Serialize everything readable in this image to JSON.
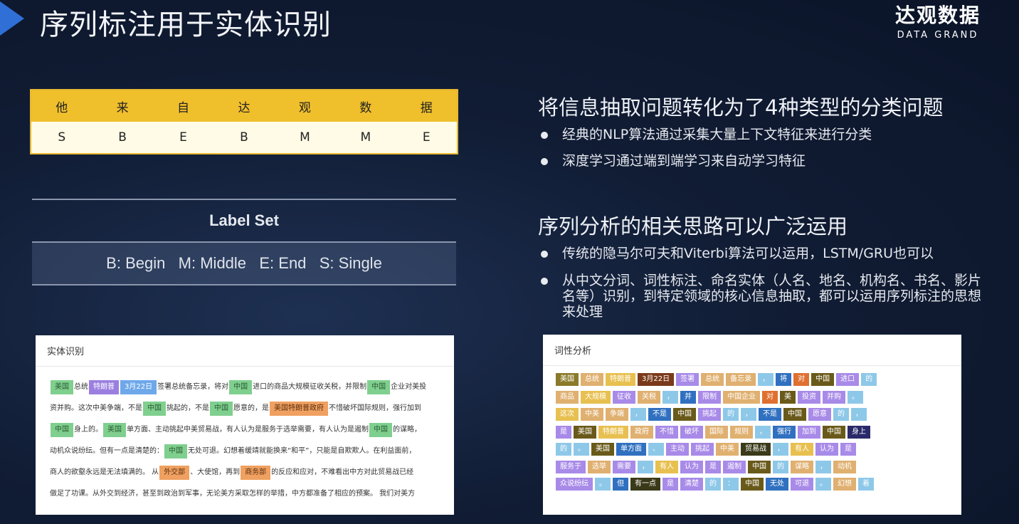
{
  "slide": {
    "title": "序列标注用于实体识别",
    "brand_cn": "达观数据",
    "brand_en": "DATA GRAND"
  },
  "sequence_table": {
    "chars": [
      "他",
      "来",
      "自",
      "达",
      "观",
      "数",
      "据"
    ],
    "labels": [
      "S",
      "B",
      "E",
      "B",
      "M",
      "M",
      "E"
    ]
  },
  "label_set": {
    "title": "Label Set",
    "text": "B: Begin   M: Middle   E: End   S: Single"
  },
  "right": {
    "heading1": "将信息抽取问题转化为了4种类型的分类问题",
    "bullets1": [
      "经典的NLP算法通过采集大量上下文特征来进行分类",
      "深度学习通过端到端学习来自动学习特征"
    ],
    "heading2": "序列分析的相关思路可以广泛运用",
    "bullets2": [
      "传统的隐马尔可夫和Viterbi算法可以运用，LSTM/GRU也可以",
      "从中文分词、词性标注、命名实体（人名、地名、机构名、书名、影片名等）识别，到特定领域的核心信息抽取，都可以运用序列标注的思想来处理"
    ]
  },
  "ner_card": {
    "title": "实体识别",
    "lines": [
      [
        [
          "g",
          "美国"
        ],
        [
          "",
          "总统"
        ],
        [
          "p",
          "特朗普"
        ],
        [
          "b",
          "3月22日"
        ],
        [
          "",
          "签署总统备忘录，将对"
        ],
        [
          "g",
          "中国"
        ],
        [
          "",
          "进口的商品大规模征收关税，并限制"
        ],
        [
          "g",
          "中国"
        ],
        [
          "",
          "企业对美投"
        ]
      ],
      [
        [
          "",
          "资并购。这次中美争端，不是"
        ],
        [
          "g",
          "中国"
        ],
        [
          "",
          "挑起的，不是"
        ],
        [
          "g",
          "中国"
        ],
        [
          "",
          "愿意的，是"
        ],
        [
          "o",
          "美国特朗普政府"
        ],
        [
          "",
          "不惜破坏国际规则，强行加到"
        ]
      ],
      [
        [
          "g",
          "中国"
        ],
        [
          "",
          "身上的。"
        ],
        [
          "g",
          "美国"
        ],
        [
          "",
          "单方面、主动挑起中美贸易战，有人认为是服务于选举需要，有人认为是遏制"
        ],
        [
          "g",
          "中国"
        ],
        [
          "",
          "的谋略，"
        ]
      ],
      [
        [
          "",
          "动机众说纷纭。但有一点是清楚的："
        ],
        [
          "g",
          "中国"
        ],
        [
          "",
          "无处可退。幻想着缓靖就能换来“和平”，只能是自欺欺人。在利益面前，"
        ]
      ],
      [
        [
          "",
          "商人的欲壑永远是无法填满的。 从"
        ],
        [
          "o",
          "外交部"
        ],
        [
          "",
          "、大使馆，再到"
        ],
        [
          "o",
          "商务部"
        ],
        [
          "",
          "的反应和应对，不难看出中方对此贸易战已经"
        ]
      ],
      [
        [
          "",
          "做足了功课。从外交到经济，甚至到政治到军事，无论美方采取怎样的举措，中方都准备了相应的预案。 我们对美方"
        ]
      ]
    ]
  },
  "pos_card": {
    "title": "词性分析",
    "rows": [
      [
        [
          "美国",
          "#8a7a2a"
        ],
        [
          "总统",
          "#e0b070"
        ],
        [
          "特朗普",
          "#e8c050"
        ],
        [
          "3月22日",
          "#7a3a1a"
        ],
        [
          "签署",
          "#a88ae8"
        ],
        [
          "总统",
          "#e0b070"
        ],
        [
          "备忘录",
          "#e0b070"
        ],
        [
          "，",
          "#8ec8e8"
        ],
        [
          "将",
          "#3070c0"
        ],
        [
          "对",
          "#e07030"
        ],
        [
          "中国",
          "#6a5a1a"
        ],
        [
          "进口",
          "#a88ae8"
        ],
        [
          "的",
          "#8ec8e8"
        ]
      ],
      [
        [
          "商品",
          "#e0b070"
        ],
        [
          "大规模",
          "#e8c050"
        ],
        [
          "征收",
          "#a88ae8"
        ],
        [
          "关税",
          "#e0b070"
        ],
        [
          "，",
          "#8ec8e8"
        ],
        [
          "并",
          "#3070c0"
        ],
        [
          "限制",
          "#a88ae8"
        ],
        [
          "中国企业",
          "#e0b070"
        ],
        [
          "对",
          "#e07030"
        ],
        [
          "美",
          "#6a5a1a"
        ],
        [
          "投资",
          "#a88ae8"
        ],
        [
          "并购",
          "#a88ae8"
        ],
        [
          "。",
          "#8ec8e8"
        ]
      ],
      [
        [
          "这次",
          "#e8c050"
        ],
        [
          "中美",
          "#e0b070"
        ],
        [
          "争端",
          "#e0b070"
        ],
        [
          "，",
          "#8ec8e8"
        ],
        [
          "不是",
          "#3070c0"
        ],
        [
          "中国",
          "#6a5a1a"
        ],
        [
          "挑起",
          "#a88ae8"
        ],
        [
          "的",
          "#8ec8e8"
        ],
        [
          "，",
          "#8ec8e8"
        ],
        [
          "不是",
          "#3070c0"
        ],
        [
          "中国",
          "#6a5a1a"
        ],
        [
          "愿意",
          "#a88ae8"
        ],
        [
          "的",
          "#8ec8e8"
        ],
        [
          "，",
          "#8ec8e8"
        ]
      ],
      [
        [
          "是",
          "#a88ae8"
        ],
        [
          "美国",
          "#6a5a1a"
        ],
        [
          "特朗普",
          "#e8c050"
        ],
        [
          "政府",
          "#e0b070"
        ],
        [
          "不惜",
          "#a88ae8"
        ],
        [
          "破坏",
          "#a88ae8"
        ],
        [
          "国际",
          "#e0b070"
        ],
        [
          "规则",
          "#e0b070"
        ],
        [
          "，",
          "#8ec8e8"
        ],
        [
          "强行",
          "#3070c0"
        ],
        [
          "加到",
          "#a88ae8"
        ],
        [
          "中国",
          "#6a5a1a"
        ],
        [
          "身上",
          "#2a2a6a"
        ]
      ],
      [
        [
          "的",
          "#8ec8e8"
        ],
        [
          "。",
          "#8ec8e8"
        ],
        [
          "美国",
          "#6a5a1a"
        ],
        [
          "单方面",
          "#3070c0"
        ],
        [
          "、",
          "#8ec8e8"
        ],
        [
          "主动",
          "#a88ae8"
        ],
        [
          "挑起",
          "#a88ae8"
        ],
        [
          "中美",
          "#e0b070"
        ],
        [
          "贸易战",
          "#3a3a1a"
        ],
        [
          "，",
          "#8ec8e8"
        ],
        [
          "有人",
          "#e8c050"
        ],
        [
          "认为",
          "#a88ae8"
        ],
        [
          "是",
          "#a88ae8"
        ]
      ],
      [
        [
          "服务于",
          "#a88ae8"
        ],
        [
          "选举",
          "#e0b070"
        ],
        [
          "需要",
          "#a88ae8"
        ],
        [
          "，",
          "#8ec8e8"
        ],
        [
          "有人",
          "#e8c050"
        ],
        [
          "认为",
          "#a88ae8"
        ],
        [
          "是",
          "#a88ae8"
        ],
        [
          "遏制",
          "#a88ae8"
        ],
        [
          "中国",
          "#6a5a1a"
        ],
        [
          "的",
          "#8ec8e8"
        ],
        [
          "谋略",
          "#e0b070"
        ],
        [
          "，",
          "#8ec8e8"
        ],
        [
          "动机",
          "#e0b070"
        ]
      ],
      [
        [
          "众说纷纭",
          "#a88ae8"
        ],
        [
          "。",
          "#8ec8e8"
        ],
        [
          "但",
          "#3070c0"
        ],
        [
          "有一点",
          "#3a3a1a"
        ],
        [
          "是",
          "#a88ae8"
        ],
        [
          "清楚",
          "#a88ae8"
        ],
        [
          "的",
          "#8ec8e8"
        ],
        [
          "：",
          "#8ec8e8"
        ],
        [
          "中国",
          "#6a5a1a"
        ],
        [
          "无处",
          "#3070c0"
        ],
        [
          "可退",
          "#a88ae8"
        ],
        [
          "。",
          "#8ec8e8"
        ],
        [
          "幻想",
          "#e0b070"
        ],
        [
          "着",
          "#8ec8e8"
        ]
      ]
    ]
  }
}
